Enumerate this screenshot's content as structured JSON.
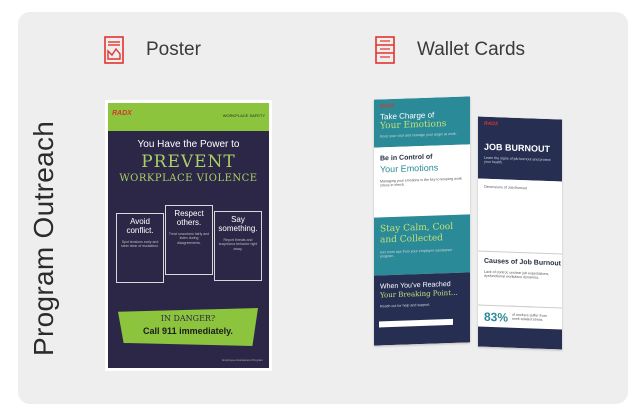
{
  "section_title": "Program Outreach",
  "items": [
    {
      "label": "Poster",
      "icon": "poster-icon"
    },
    {
      "label": "Wallet Cards",
      "icon": "wallet-cards-icon"
    }
  ],
  "colors": {
    "accent_red": "#e3342f",
    "panel_bg": "#eeeeee",
    "poster_bg": "#2c2747",
    "poster_green": "#8cc43d",
    "card_teal": "#2a8a97",
    "card_navy": "#262f52"
  },
  "poster": {
    "logo": "RADX",
    "top_right": "WORKPLACE SAFETY",
    "title_line1": "You Have the Power to",
    "title_line2": "PREVENT",
    "title_line3": "WORKPLACE VIOLENCE",
    "columns": [
      {
        "title": "Avoid conflict.",
        "text": "Spot tensions early and steer clear of escalation."
      },
      {
        "title": "Respect others.",
        "text": "Treat coworkers fairly and listen during disagreements."
      },
      {
        "title": "Say something.",
        "text": "Report threats and suspicious behavior right away."
      }
    ],
    "banner_line1": "IN DANGER?",
    "banner_line2": "Call 911 immediately.",
    "footnote": "Employee Assistance Program"
  },
  "wallet_cards": {
    "logo": "RADX",
    "left": {
      "card1_line1": "Take Charge of",
      "card1_line2": "Your Emotions",
      "card1_sub": "Keep your cool and manage your anger at work.",
      "card2_line1": "Be in Control of",
      "card2_line2": "Your Emotions",
      "card2_sub": "Managing your emotions is the key to keeping work stress in check.",
      "card3_line1": "Stay Calm, Cool",
      "card3_line2": "and Collected",
      "card3_sub": "Get more tips from your employee assistance program.",
      "card4_line1": "When You've Reached",
      "card4_line2": "Your Breaking Point...",
      "card4_sub": "Reach out for help and support."
    },
    "right": {
      "title": "JOB BURNOUT",
      "sub": "Learn the signs of job burnout and protect your health.",
      "triangle_label": "Dimensions of Job Burnout",
      "causes_title": "Causes of Job Burnout",
      "causes_sub": "Lack of control, unclear job expectations, dysfunctional workplace dynamics.",
      "stat": "83%",
      "stat_sub": "of workers suffer from work-related stress."
    }
  }
}
